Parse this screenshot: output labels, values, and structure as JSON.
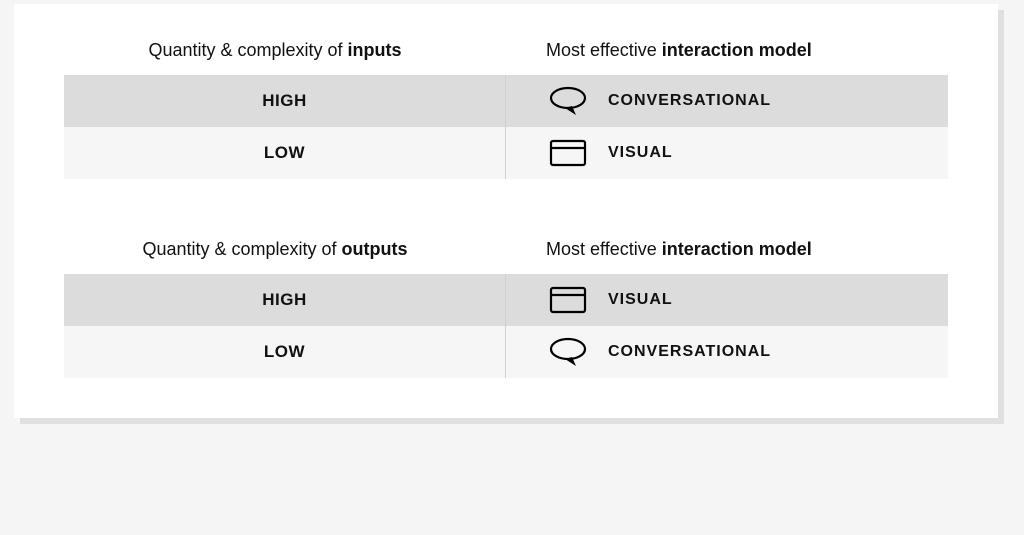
{
  "sections": [
    {
      "header_left_prefix": "Quantity & complexity of  ",
      "header_left_bold": "inputs",
      "header_right_prefix": "Most effective ",
      "header_right_bold": "interaction model",
      "rows": [
        {
          "level": "HIGH",
          "model": "CONVERSATIONAL",
          "icon": "speech"
        },
        {
          "level": "LOW",
          "model": "VISUAL",
          "icon": "window"
        }
      ]
    },
    {
      "header_left_prefix": "Quantity & complexity of ",
      "header_left_bold": "outputs",
      "header_right_prefix": "Most effective ",
      "header_right_bold": "interaction model",
      "rows": [
        {
          "level": "HIGH",
          "model": "VISUAL",
          "icon": "window"
        },
        {
          "level": "LOW",
          "model": "CONVERSATIONAL",
          "icon": "speech"
        }
      ]
    }
  ]
}
